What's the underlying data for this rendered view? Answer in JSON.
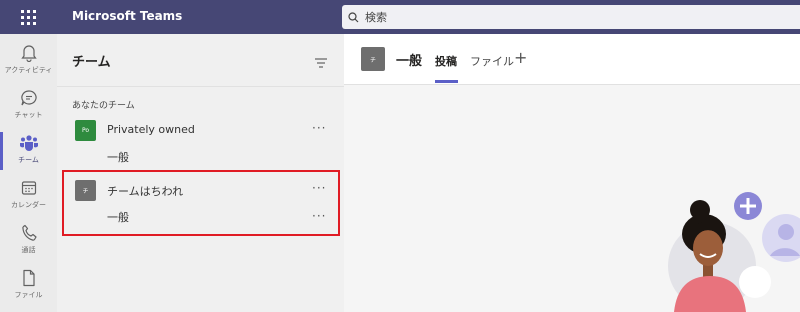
{
  "app": {
    "title": "Microsoft Teams"
  },
  "search": {
    "placeholder": "検索"
  },
  "rail": [
    {
      "label": "アクティビティ",
      "icon": "bell-icon"
    },
    {
      "label": "チャット",
      "icon": "chat-icon"
    },
    {
      "label": "チーム",
      "icon": "teams-icon",
      "active": true
    },
    {
      "label": "カレンダー",
      "icon": "calendar-icon"
    },
    {
      "label": "通話",
      "icon": "phone-icon"
    },
    {
      "label": "ファイル",
      "icon": "file-icon"
    }
  ],
  "teams_panel": {
    "title": "チーム",
    "section_label": "あなたのチーム",
    "teams": [
      {
        "name": "Privately owned",
        "avatar": "Po",
        "avatar_color": "#2e8b3e",
        "channel": "一般",
        "more": "···"
      },
      {
        "name": "チームはちわれ",
        "avatar": "チ",
        "avatar_color": "#6e6e6e",
        "channel": "一般",
        "more": "···",
        "channel_more": "···"
      }
    ]
  },
  "channel": {
    "avatar": "チ",
    "title": "一般",
    "tabs": [
      "投稿",
      "ファイル"
    ],
    "active_tab": "投稿",
    "add_tab": "+"
  },
  "colors": {
    "topbar": "#464775",
    "accent": "#5b5fc7",
    "highlight": "#e01b24"
  }
}
